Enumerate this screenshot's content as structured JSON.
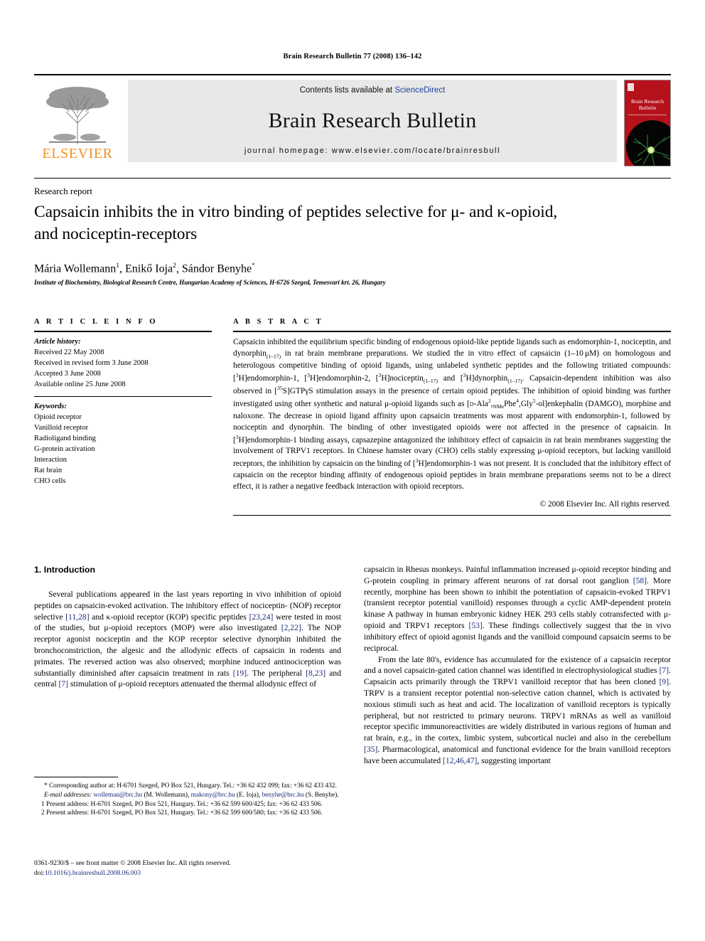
{
  "running_head": "Brain Research Bulletin 77 (2008) 136–142",
  "masthead": {
    "contents_prefix": "Contents lists available at ",
    "sciencedirect": "ScienceDirect",
    "journal_title": "Brain Research Bulletin",
    "homepage": "journal homepage: www.elsevier.com/locate/brainresbull",
    "publisher": "ELSEVIER",
    "cover_title_line1": "Brain Research",
    "cover_title_line2": "Bulletin",
    "brand_orange": "#F7901E",
    "cover_red": "#b5121b",
    "link_blue": "#1a3fa0"
  },
  "kicker": "Research report",
  "title_line1": "Capsaicin inhibits the in vitro binding of peptides selective for μ- and κ-opioid,",
  "title_line2": "and nociceptin-receptors",
  "authors": [
    {
      "name": "Mária Wollemann",
      "mark": "1"
    },
    {
      "name": "Enikő Ioja",
      "mark": "2"
    },
    {
      "name": "Sándor Benyhe",
      "mark": "*"
    }
  ],
  "affiliation": "Institute of Biochemistry, Biological Research Centre, Hungarian Academy of Sciences, H-6726 Szeged, Temesvari krt. 26, Hungary",
  "article_info": {
    "heading": "A R T I C L E   I N F O",
    "history_label": "Article history:",
    "history": [
      "Received 22 May 2008",
      "Received in revised form 3 June 2008",
      "Accepted 3 June 2008",
      "Available online 25 June 2008"
    ],
    "keywords_label": "Keywords:",
    "keywords": [
      "Opioid receptor",
      "Vanilloid receptor",
      "Radioligand binding",
      "G-protein activation",
      "Interaction",
      "Rat brain",
      "CHO cells"
    ]
  },
  "abstract": {
    "heading": "A B S T R A C T",
    "copyright": "© 2008 Elsevier Inc. All rights reserved."
  },
  "intro": {
    "heading": "1.  Introduction",
    "left_p1": "Several publications appeared in the last years reporting in vivo inhibition of opioid peptides on capsaicin-evoked activation. The inhibitory effect of nociceptin- (NOP) receptor selective [11,28] and κ-opioid receptor (KOP) specific peptides [23,24] were tested in most of the studies, but μ-opioid receptors (MOP) were also investigated [2,22]. The NOP receptor agonist nociceptin and the KOP receptor selective dynorphin inhibited the bronchoconstriction, the algesic and the allodynic effects of capsaicin in rodents and primates. The reversed action was also observed; morphine induced antinociception was substantially diminished after capsaicin treatment in rats [19]. The peripheral [8,23] and central [7] stimulation of μ-opioid receptors attenuated the thermal allodynic effect of",
    "right_p1": "capsaicin in Rhesus monkeys. Painful inflammation increased μ-opioid receptor binding and G-protein coupling in primary afferent neurons of rat dorsal root ganglion [58]. More recently, morphine has been shown to inhibit the potentiation of capsaicin-evoked TRPV1 (transient receptor potential vanilloid) responses through a cyclic AMP-dependent protein kinase A pathway in human embryonic kidney HEK 293 cells stably cotransfected with μ-opioid and TRPV1 receptors [53]. These findings collectively suggest that the in vivo inhibitory effect of opioid agonist ligands and the vanilloid compound capsaicin seems to be reciprocal.",
    "right_p2": "From the late 80's, evidence has accumulated for the existence of a capsaicin receptor and a novel capsaicin-gated cation channel was identified in electrophysiological studies [7]. Capsaicin acts primarily through the TRPV1 vanilloid receptor that has been cloned [9]. TRPV is a transient receptor potential non-selective cation channel, which is activated by noxious stimuli such as heat and acid. The localization of vanilloid receptors is typically peripheral, but not restricted to primary neurons. TRPV1 mRNAs as well as vanilloid receptor specific immunoreactivities are widely distributed in various regions of human and rat brain, e.g., in the cortex, limbic system, subcortical nuclei and also in the cerebellum [35]. Pharmacological, anatomical and functional evidence for the brain vanilloid receptors have been accumulated [12,46,47], suggesting important"
  },
  "footnotes": {
    "corresponding": "* Corresponding author at: H-6701 Szeged, PO Box 521, Hungary. Tel.: +36 62 432 099; fax: +36 62 433 432.",
    "email_label": "E-mail addresses:",
    "emails": [
      {
        "addr": "wolleman@brc.hu",
        "who": "(M. Wollemann)"
      },
      {
        "addr": "makony@brc.hu",
        "who": "(E. Ioja)"
      },
      {
        "addr": "benyhe@brc.hu",
        "who": "(S. Benyhe)"
      }
    ],
    "note1": "1  Present address: H-6701 Szeged, PO Box 521, Hungary. Tel.: +36 62 599 600/425; fax: +36 62 433 506.",
    "note2": "2  Present address: H-6701 Szeged, PO Box 521, Hungary. Tel.: +36 62 599 600/580; fax: +36 62 433 506."
  },
  "imprint": {
    "line1": "0361-9230/$ – see front matter © 2008 Elsevier Inc. All rights reserved.",
    "doi_prefix": "doi:",
    "doi": "10.1016/j.brainresbull.2008.06.003"
  }
}
